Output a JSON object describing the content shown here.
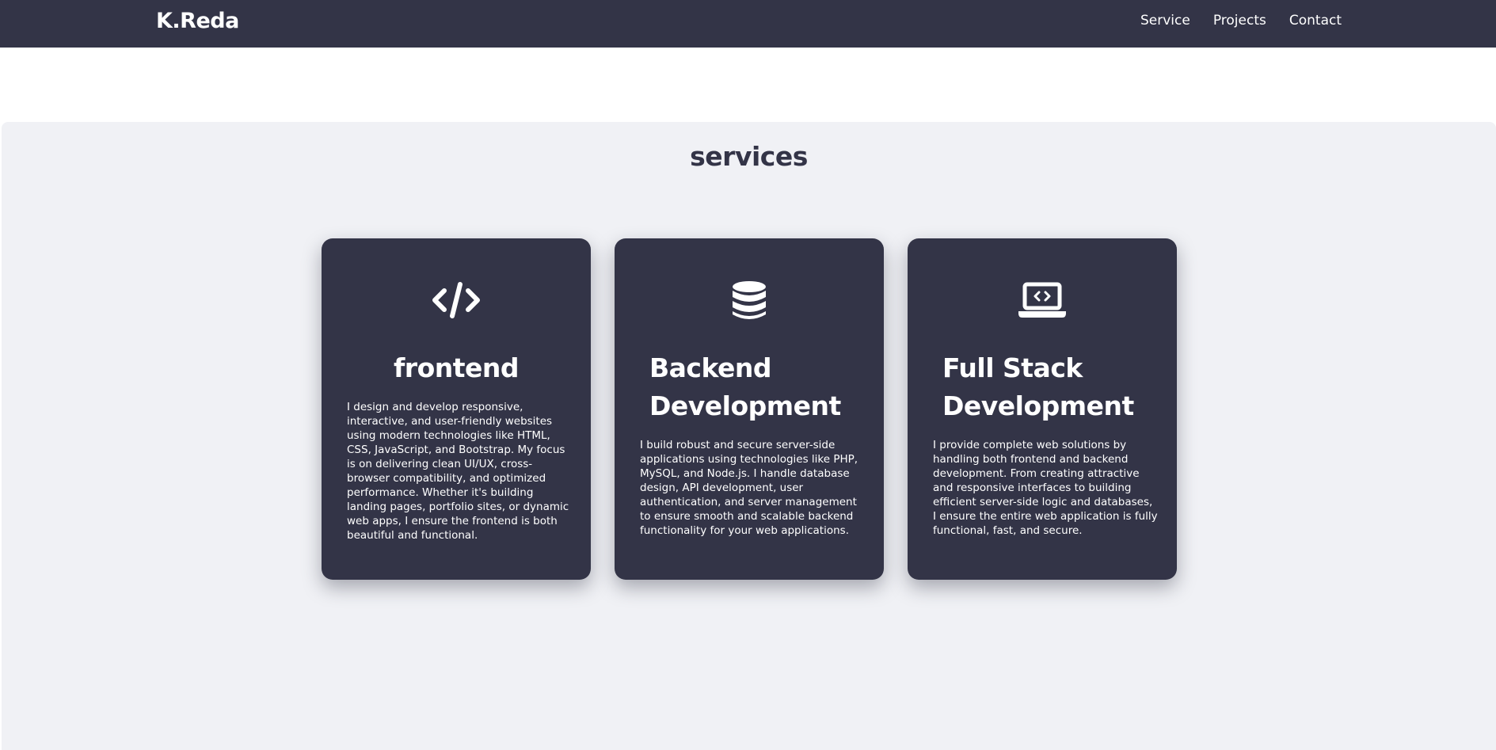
{
  "header": {
    "brand": "K.Reda",
    "nav": [
      "Service",
      "Projects",
      "Contact"
    ]
  },
  "services": {
    "title": "services",
    "cards": [
      {
        "icon": "code-icon",
        "title": "frontend",
        "text": "I design and develop responsive, interactive, and user-friendly websites using modern technologies like HTML, CSS, JavaScript, and Bootstrap. My focus is on delivering clean UI/UX, cross-browser compatibility, and optimized performance. Whether it's building landing pages, portfolio sites, or dynamic web apps, I ensure the frontend is both beautiful and functional."
      },
      {
        "icon": "database-icon",
        "title": "Backend Development",
        "text": "I build robust and secure server-side applications using technologies like PHP, MySQL, and Node.js. I handle database design, API development, user authentication, and server management to ensure smooth and scalable backend functionality for your web applications."
      },
      {
        "icon": "laptop-code-icon",
        "title": "Full Stack Development",
        "text": "I provide complete web solutions by handling both frontend and backend development. From creating attractive and responsive interfaces to building efficient server-side logic and databases, I ensure the entire web application is fully functional, fast, and secure."
      }
    ]
  },
  "colors": {
    "navbar": "#333447",
    "section_background": "#f0f1f5",
    "card": "#333447",
    "text_light": "#ffffff",
    "title_dark": "#333447"
  }
}
